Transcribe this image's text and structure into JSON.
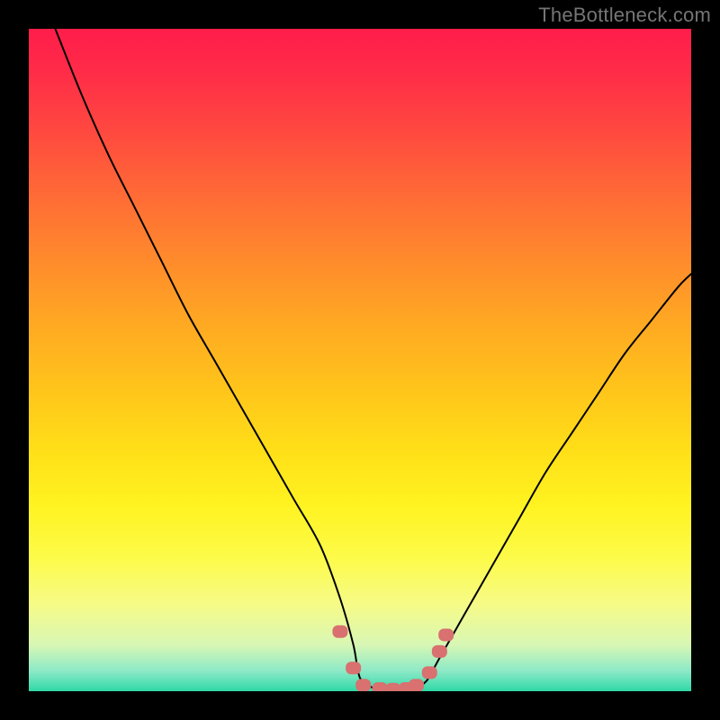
{
  "watermark": "TheBottleneck.com",
  "chart_data": {
    "type": "line",
    "title": "",
    "xlabel": "",
    "ylabel": "",
    "xlim": [
      0,
      100
    ],
    "ylim": [
      0,
      100
    ],
    "grid": false,
    "legend": false,
    "series": [
      {
        "name": "bottleneck-curve",
        "x": [
          4,
          8,
          12,
          16,
          20,
          24,
          28,
          32,
          36,
          40,
          44,
          47,
          49,
          50,
          52,
          54,
          56,
          58,
          60,
          62,
          66,
          70,
          74,
          78,
          82,
          86,
          90,
          94,
          98,
          100
        ],
        "y": [
          100,
          90,
          81,
          73,
          65,
          57,
          50,
          43,
          36,
          29,
          22,
          14,
          7,
          2,
          0.5,
          0.3,
          0.3,
          0.5,
          1.5,
          5,
          12,
          19,
          26,
          33,
          39,
          45,
          51,
          56,
          61,
          63
        ]
      }
    ],
    "markers": {
      "name": "highlight-dots",
      "color": "#d8716f",
      "points": [
        {
          "x": 47.0,
          "y": 9.0
        },
        {
          "x": 49.0,
          "y": 3.5
        },
        {
          "x": 50.5,
          "y": 0.9
        },
        {
          "x": 53.0,
          "y": 0.4
        },
        {
          "x": 55.0,
          "y": 0.3
        },
        {
          "x": 57.0,
          "y": 0.4
        },
        {
          "x": 58.5,
          "y": 0.9
        },
        {
          "x": 60.5,
          "y": 2.8
        },
        {
          "x": 62.0,
          "y": 6.0
        },
        {
          "x": 63.0,
          "y": 8.5
        }
      ]
    }
  }
}
